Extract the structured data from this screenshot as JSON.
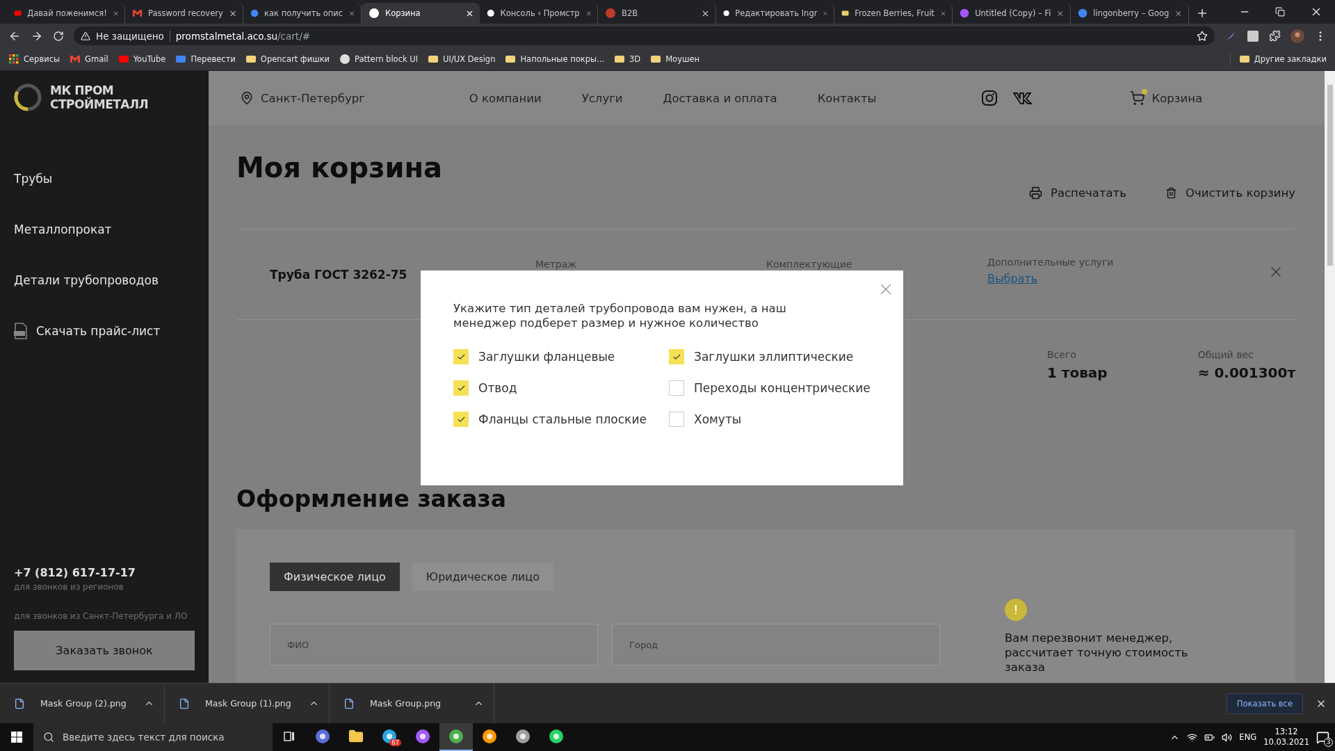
{
  "browser": {
    "tabs": [
      {
        "kind": "video",
        "label": "Давай поженимся!",
        "selected": false
      },
      {
        "kind": "mail",
        "label": "Password recovery",
        "selected": false
      },
      {
        "kind": "search",
        "label": "как получить опис",
        "selected": false
      },
      {
        "kind": "blog",
        "label": "Корзина",
        "selected": true
      },
      {
        "kind": "blog",
        "label": "Консоль ‹ Промстр",
        "selected": false
      },
      {
        "kind": "fruit",
        "label": "B2B",
        "selected": false
      },
      {
        "kind": "blog",
        "label": "Редактировать Ingr",
        "selected": false
      },
      {
        "kind": "berries",
        "label": "Frozen Berries, Fruit",
        "selected": false
      },
      {
        "kind": "design",
        "label": "Untitled (Copy) – Fi",
        "selected": false
      },
      {
        "kind": "search",
        "label": "lingonberry – Goog",
        "selected": false
      }
    ],
    "security": "Не защищено",
    "url_host": "promstalmetal.aco.su",
    "url_path": "/cart/#",
    "bookmarks": [
      {
        "kind": "apps",
        "label": "Сервисы"
      },
      {
        "kind": "mail",
        "label": "Gmail"
      },
      {
        "kind": "video",
        "label": "YouTube"
      },
      {
        "kind": "translate",
        "label": "Перевести"
      },
      {
        "kind": "folder",
        "label": "Opencart фишки"
      },
      {
        "kind": "pattern",
        "label": "Pattern block UI"
      },
      {
        "kind": "folder",
        "label": "UI/UX Design"
      },
      {
        "kind": "folder",
        "label": "Напольные покры..."
      },
      {
        "kind": "folder",
        "label": "3D"
      },
      {
        "kind": "folder",
        "label": "Моушен"
      }
    ],
    "other_bookmarks": "Другие закладки"
  },
  "sidebar": {
    "logo": [
      "МК ПРОМ",
      "СТРОЙМЕТАЛЛ"
    ],
    "nav": [
      {
        "kind": "link",
        "label": "Трубы"
      },
      {
        "kind": "link",
        "label": "Металлопрокат"
      },
      {
        "kind": "link",
        "label": "Детали трубопроводов"
      },
      {
        "kind": "download",
        "label": "Скачать прайс-лист"
      }
    ],
    "phone": "+7 (812) 617-17-17",
    "phone_note": "для звонков из регионов",
    "city_note": "для звонков из Санкт-Петербурга и ЛО",
    "call_button": "Заказать звонок"
  },
  "header": {
    "city": "Санкт-Петербург",
    "nav": [
      "О компании",
      "Услуги",
      "Доставка и оплата",
      "Контакты"
    ],
    "cart": "Корзина"
  },
  "cart": {
    "title": "Моя корзина",
    "actions": [
      {
        "kind": "print",
        "label": "Распечатать"
      },
      {
        "kind": "clear",
        "label": "Очистить корзину"
      }
    ],
    "item": {
      "name": "Труба ГОСТ 3262-75",
      "columns": [
        "Метраж",
        "Комплектующие"
      ],
      "extras_label": "Дополнительные услуги",
      "extras_link": "Выбрать"
    },
    "summary": [
      {
        "label": "Всего",
        "value": "1 товар"
      },
      {
        "label": "Общий вес",
        "value": "≈ 0.001300т"
      }
    ]
  },
  "order": {
    "title": "Оформление заказа",
    "tabs": [
      {
        "label": "Физическое лицо",
        "selected": true
      },
      {
        "label": "Юридическое лицо",
        "selected": false
      }
    ],
    "fields": [
      {
        "placeholder": "ФИО"
      },
      {
        "placeholder": "Город"
      }
    ],
    "notice": "Вам перезвонит менеджер, рассчитает точную стоимость заказа"
  },
  "modal": {
    "text": "Укажите тип деталей трубопровода вам нужен, а наш менеджер подберет размер и нужное количество",
    "options": [
      {
        "label": "Заглушки фланцевые",
        "checked": true
      },
      {
        "label": "Заглушки эллиптические",
        "checked": true
      },
      {
        "label": "Отвод",
        "checked": true
      },
      {
        "label": "Переходы концентрические",
        "checked": false
      },
      {
        "label": "Фланцы стальные плоские",
        "checked": true
      },
      {
        "label": "Хомуты",
        "checked": false
      }
    ]
  },
  "downloads": {
    "files": [
      "Mask Group (2).png",
      "Mask Group (1).png",
      "Mask Group.png"
    ],
    "show_all": "Показать все"
  },
  "taskbar": {
    "search": "Введите здесь текст для поиска",
    "apps": [
      {
        "kind": "taskview",
        "selected": false
      },
      {
        "kind": "disc",
        "selected": false
      },
      {
        "kind": "folder",
        "selected": false
      },
      {
        "kind": "messenger",
        "selected": false,
        "badge": "67"
      },
      {
        "kind": "design",
        "selected": false
      },
      {
        "kind": "browser",
        "selected": true
      },
      {
        "kind": "editor",
        "selected": false
      },
      {
        "kind": "network",
        "selected": false
      },
      {
        "kind": "chat",
        "selected": false
      }
    ],
    "lang": "ENG",
    "time": "13:12",
    "date": "10.03.2021",
    "notifications": "3"
  }
}
